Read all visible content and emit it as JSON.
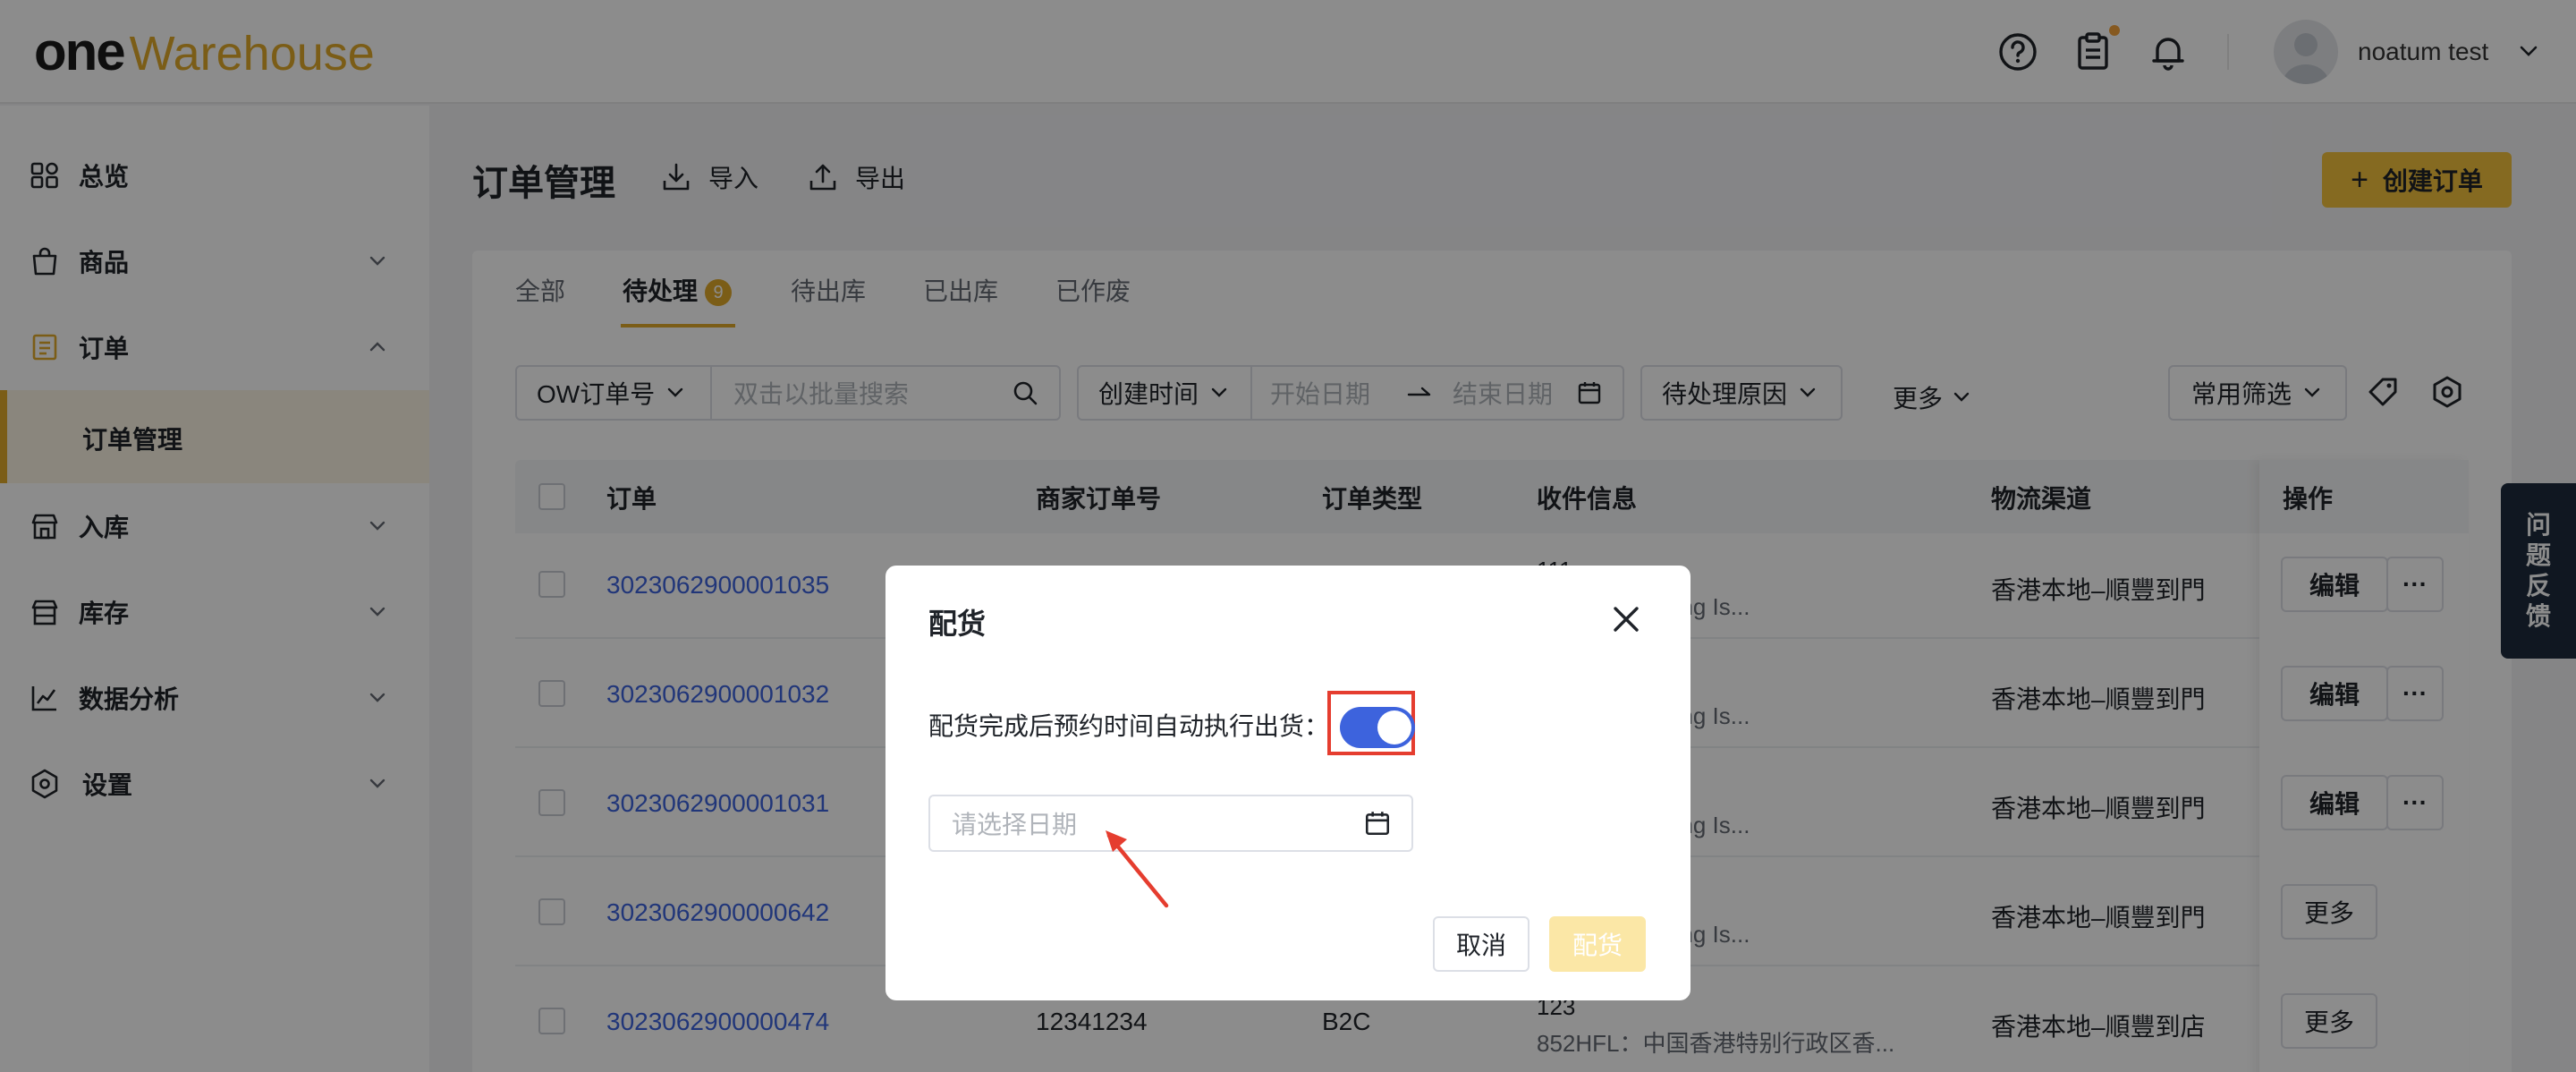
{
  "header": {
    "logo_one": "one",
    "logo_rest": "Warehouse",
    "username": "noatum test"
  },
  "sidebar": {
    "items": [
      {
        "label": "总览"
      },
      {
        "label": "商品"
      },
      {
        "label": "订单"
      },
      {
        "label": "订单管理"
      },
      {
        "label": "入库"
      },
      {
        "label": "库存"
      },
      {
        "label": "数据分析"
      },
      {
        "label": "设置"
      }
    ]
  },
  "main": {
    "title": "订单管理",
    "import_label": "导入",
    "export_label": "导出",
    "create_label": "创建订单",
    "tabs": [
      {
        "label": "全部"
      },
      {
        "label": "待处理",
        "badge": "9"
      },
      {
        "label": "待出库"
      },
      {
        "label": "已出库"
      },
      {
        "label": "已作废"
      }
    ],
    "filters": {
      "order_no_select": "OW订单号",
      "search_placeholder": "双击以批量搜索",
      "time_select": "创建时间",
      "start_placeholder": "开始日期",
      "end_placeholder": "结束日期",
      "reason_select": "待处理原因",
      "more": "更多",
      "common_filter": "常用筛选"
    },
    "table": {
      "headers": [
        "订单",
        "商家订单号",
        "订单类型",
        "收件信息",
        "物流渠道",
        "操作"
      ],
      "rows": [
        {
          "order": "3023062900001035",
          "merchant": "",
          "type": "",
          "recv_top": "111",
          "recv": "政区 Hong Kong Is...",
          "channel": "香港本地–順豐到門",
          "ops": [
            "编辑",
            "···"
          ]
        },
        {
          "order": "3023062900001032",
          "merchant": "",
          "type": "",
          "recv_top": "",
          "recv": "政区 Hong Kong Is...",
          "channel": "香港本地–順豐到門",
          "ops": [
            "编辑",
            "···"
          ]
        },
        {
          "order": "3023062900001031",
          "merchant": "",
          "type": "",
          "recv_top": "",
          "recv": "政区 Hong Kong Is...",
          "channel": "香港本地–順豐到門",
          "ops": [
            "编辑",
            "···"
          ]
        },
        {
          "order": "3023062900000642",
          "merchant": "",
          "type": "",
          "recv_top": "",
          "recv": "政区 Hong Kong Is...",
          "channel": "香港本地–順豐到門",
          "ops": [
            "更多"
          ]
        },
        {
          "order": "3023062900000474",
          "merchant": "12341234",
          "type": "B2C",
          "recv_top": "123",
          "recv": "852HFL：中国香港特别行政区香...",
          "channel": "香港本地–順豐到店",
          "ops": [
            "更多"
          ]
        }
      ]
    }
  },
  "feedback": [
    "问",
    "题",
    "反",
    "馈"
  ],
  "dialog": {
    "title": "配货",
    "toggle_label": "配货完成后预约时间自动执行出货：",
    "toggle_on": true,
    "date_placeholder": "请选择日期",
    "cancel_label": "取消",
    "confirm_label": "配货"
  },
  "colors": {
    "brand": "#e1a92a",
    "link": "#3d63dd",
    "toggle": "#3d63dd",
    "highlight": "#e53d2f"
  }
}
